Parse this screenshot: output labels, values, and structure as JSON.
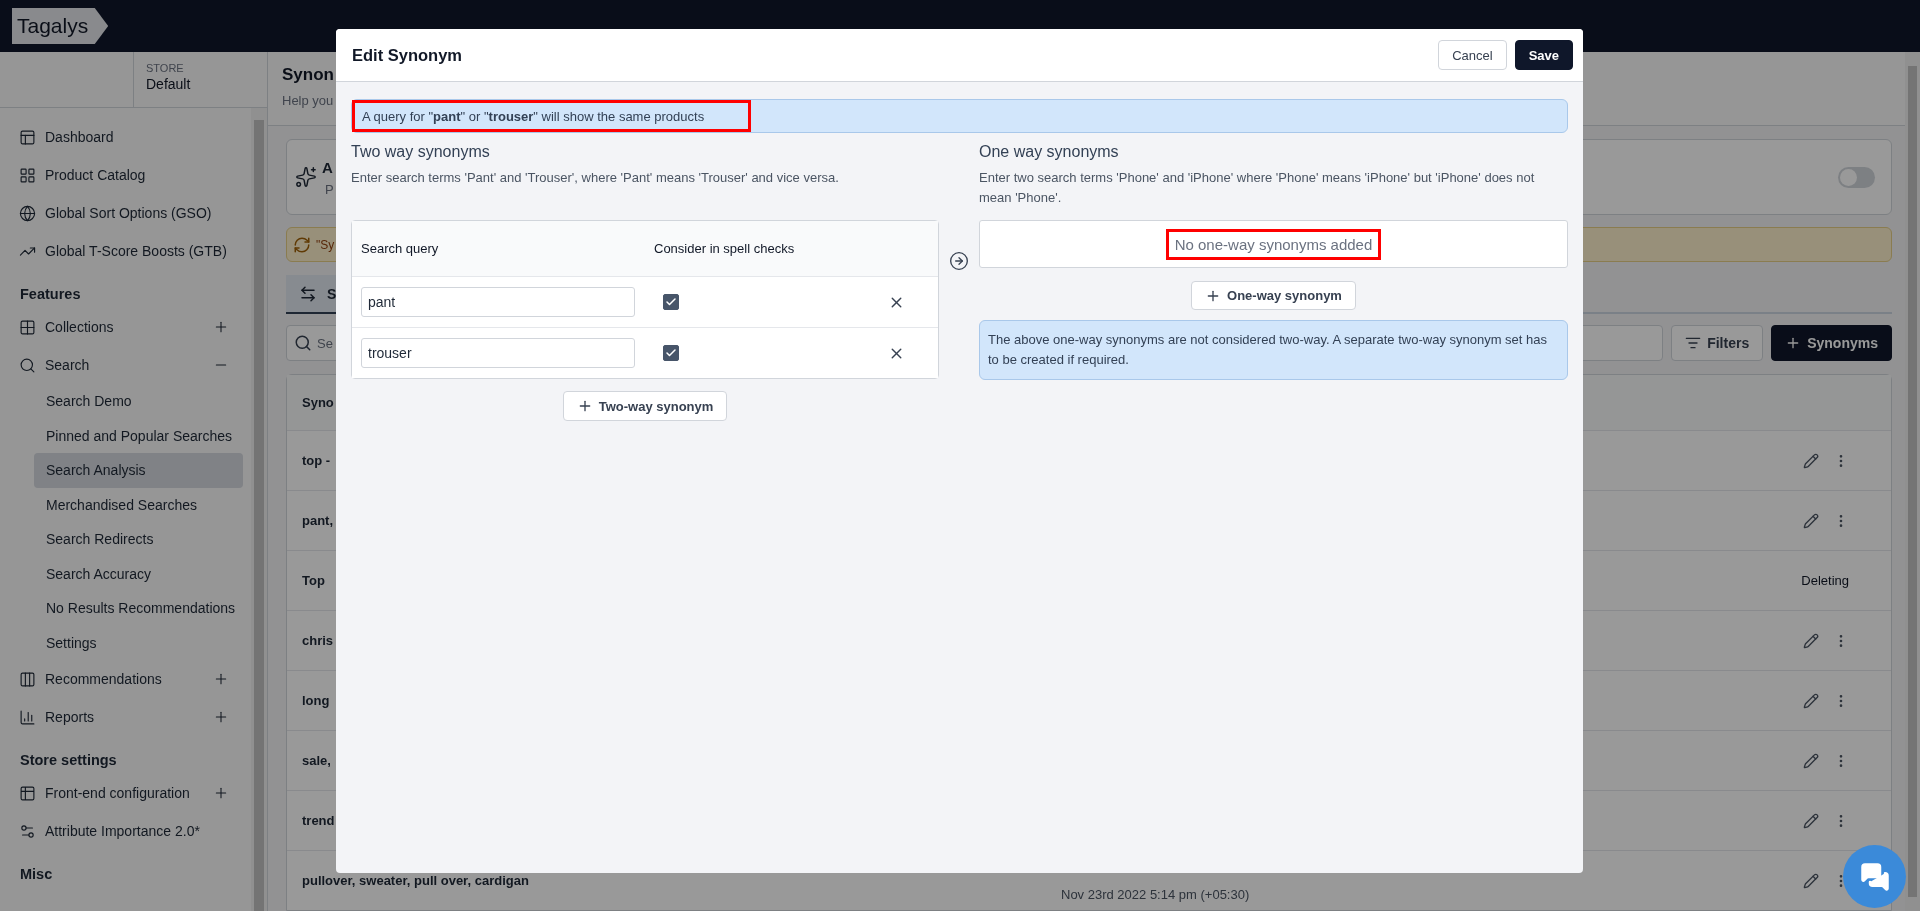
{
  "topbar": {
    "logo": "Tagalys"
  },
  "sidebar": {
    "store_label": "STORE",
    "store_value": "Default",
    "sections": [
      {
        "items": [
          {
            "label": "Dashboard"
          },
          {
            "label": "Product Catalog"
          },
          {
            "label": "Global Sort Options (GSO)"
          },
          {
            "label": "Global T-Score Boosts (GTB)"
          }
        ]
      },
      {
        "heading": "Features",
        "items": [
          {
            "label": "Collections",
            "expanded": false
          },
          {
            "label": "Search",
            "expanded": true,
            "children": [
              {
                "label": "Search Demo",
                "selected": false
              },
              {
                "label": "Pinned and Popular Searches",
                "selected": false
              },
              {
                "label": "Search Analysis",
                "selected": true
              },
              {
                "label": "Merchandised Searches",
                "selected": false
              },
              {
                "label": "Search Redirects",
                "selected": false
              },
              {
                "label": "Search Accuracy",
                "selected": false
              },
              {
                "label": "No Results Recommendations",
                "selected": false
              },
              {
                "label": "Settings",
                "selected": false
              }
            ]
          },
          {
            "label": "Recommendations",
            "expanded": false
          },
          {
            "label": "Reports",
            "expanded": false
          }
        ]
      },
      {
        "heading": "Store settings",
        "items": [
          {
            "label": "Front-end configuration",
            "expanded": false
          },
          {
            "label": "Attribute Importance 2.0*"
          }
        ]
      },
      {
        "heading": "Misc"
      }
    ]
  },
  "page": {
    "title": "Synon",
    "subtitle": "Help you",
    "card": {
      "title": "A",
      "text": "P",
      "toggle_on": false
    },
    "alert": "\"Sy",
    "tab": {
      "label": "S",
      "selected": true
    },
    "search": {
      "placeholder": "Se"
    },
    "filters_button": "Filters",
    "add_button": "Synonyms",
    "table": {
      "column_1": "Syno",
      "rows": [
        {
          "name": "top -",
          "kind": "normal"
        },
        {
          "name": "pant,",
          "kind": "normal"
        },
        {
          "name": "Top",
          "kind": "deleting",
          "status": "Deleting"
        },
        {
          "name": "chris",
          "kind": "normal"
        },
        {
          "name": "long",
          "kind": "normal"
        },
        {
          "name": "sale,",
          "kind": "normal"
        },
        {
          "name": "trend",
          "kind": "normal"
        },
        {
          "name": "pullover, sweater, pull over, cardigan",
          "kind": "normal",
          "date": "Nov 23rd 2022 5:14 pm (+05:30)"
        }
      ]
    }
  },
  "modal": {
    "title": "Edit Synonym",
    "cancel": "Cancel",
    "save": "Save",
    "info": {
      "text": "A query for \"**pant**\" or \"**trouser**\" will show the same products",
      "highlighted": true
    },
    "two_way": {
      "title": "Two way synonyms",
      "description": "Enter search terms 'Pant' and 'Trouser', where 'Pant' means 'Trouser' and vice versa.",
      "columns": [
        "Search query",
        "Consider in spell checks"
      ],
      "rows": [
        {
          "value": "pant",
          "checked": true
        },
        {
          "value": "trouser",
          "checked": true
        }
      ],
      "add_button": "Two-way synonym"
    },
    "one_way": {
      "title": "One way synonyms",
      "description": "Enter two search terms 'Phone' and 'iPhone' where 'Phone' means 'iPhone' but 'iPhone' does not mean 'Phone'.",
      "empty": {
        "text": "No one-way synonyms added",
        "highlighted": true
      },
      "add_button": "One-way synonym",
      "note": "The above one-way synonyms are not considered two-way. A separate two-way synonym set has to be created if required."
    }
  }
}
